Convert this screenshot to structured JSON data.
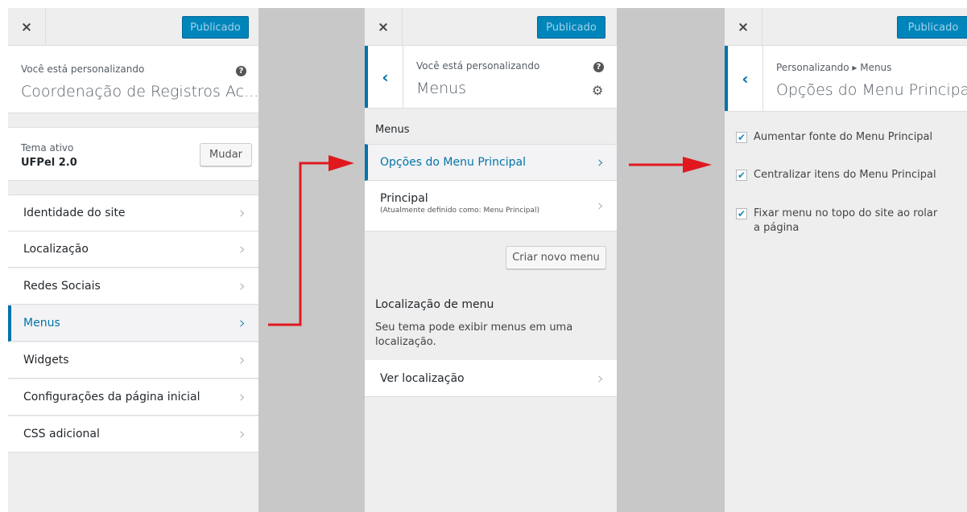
{
  "colors": {
    "accent": "#0073aa",
    "arrow": "#e0191f",
    "publish": "#0085ba"
  },
  "panel1": {
    "close_icon": "×",
    "publish_label": "Publicado",
    "info": {
      "small": "Você está personalizando",
      "big": "Coordenação de Registros Ac...",
      "help_icon": "?"
    },
    "theme": {
      "label": "Tema ativo",
      "name": "UFPel 2.0",
      "change_label": "Mudar"
    },
    "items": [
      {
        "label": "Identidade do site"
      },
      {
        "label": "Localização"
      },
      {
        "label": "Redes Sociais"
      },
      {
        "label": "Menus"
      },
      {
        "label": "Widgets"
      },
      {
        "label": "Configurações da página inicial"
      },
      {
        "label": "CSS adicional"
      }
    ]
  },
  "panel2": {
    "close_icon": "×",
    "publish_label": "Publicado",
    "info": {
      "small": "Você está personalizando",
      "big": "Menus",
      "help_icon": "?",
      "back_icon": "‹"
    },
    "section_title": "Menus",
    "items": [
      {
        "label": "Opções do Menu Principal"
      },
      {
        "label": "Principal",
        "sub": "(Atualmente definido como: Menu Principal)"
      }
    ],
    "create_label": "Criar novo menu",
    "location_title": "Localização de menu",
    "location_desc": "Seu tema pode exibir menus em uma localização.",
    "view_location_label": "Ver localização"
  },
  "panel3": {
    "close_icon": "×",
    "publish_label": "Publicado",
    "info": {
      "breadcrumb": "Personalizando ▸ Menus",
      "big": "Opções do Menu Principal",
      "back_icon": "‹"
    },
    "options": [
      {
        "label": "Aumentar fonte do Menu Principal",
        "checked": true
      },
      {
        "label": "Centralizar itens do Menu Principal",
        "checked": true
      },
      {
        "label": "Fixar menu no topo do site ao rolar a página",
        "checked": true
      }
    ]
  }
}
